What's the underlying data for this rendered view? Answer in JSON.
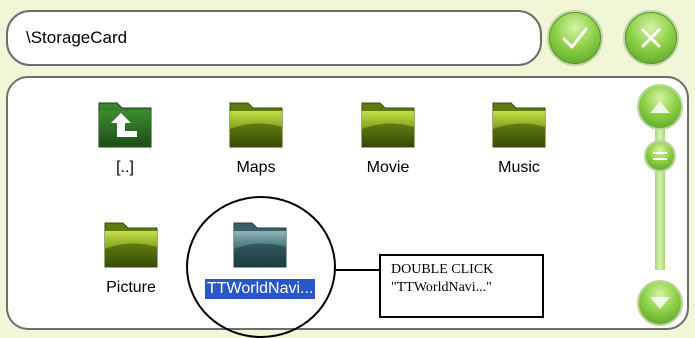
{
  "path": {
    "value": "\\StorageCard"
  },
  "buttons": {
    "ok": "check-icon",
    "cancel": "close-icon"
  },
  "items": [
    {
      "label": "[..]",
      "icon": "folder-up-icon"
    },
    {
      "label": "Maps",
      "icon": "folder-icon"
    },
    {
      "label": "Movie",
      "icon": "folder-icon"
    },
    {
      "label": "Music",
      "icon": "folder-icon"
    },
    {
      "label": "Picture",
      "icon": "folder-icon"
    },
    {
      "label": "TTWorldNavi...",
      "icon": "folder-icon",
      "selected": true
    }
  ],
  "annotation": {
    "line1": "DOUBLE CLICK",
    "line2": "\"TTWorldNavi...\""
  },
  "scrollbar": {
    "up": "arrow-up-icon",
    "down": "arrow-down-icon",
    "position": 0.0
  },
  "colors": {
    "accent_green": "#8ed147",
    "selection_blue": "#2a57c8",
    "background": "#f1f6d6"
  }
}
